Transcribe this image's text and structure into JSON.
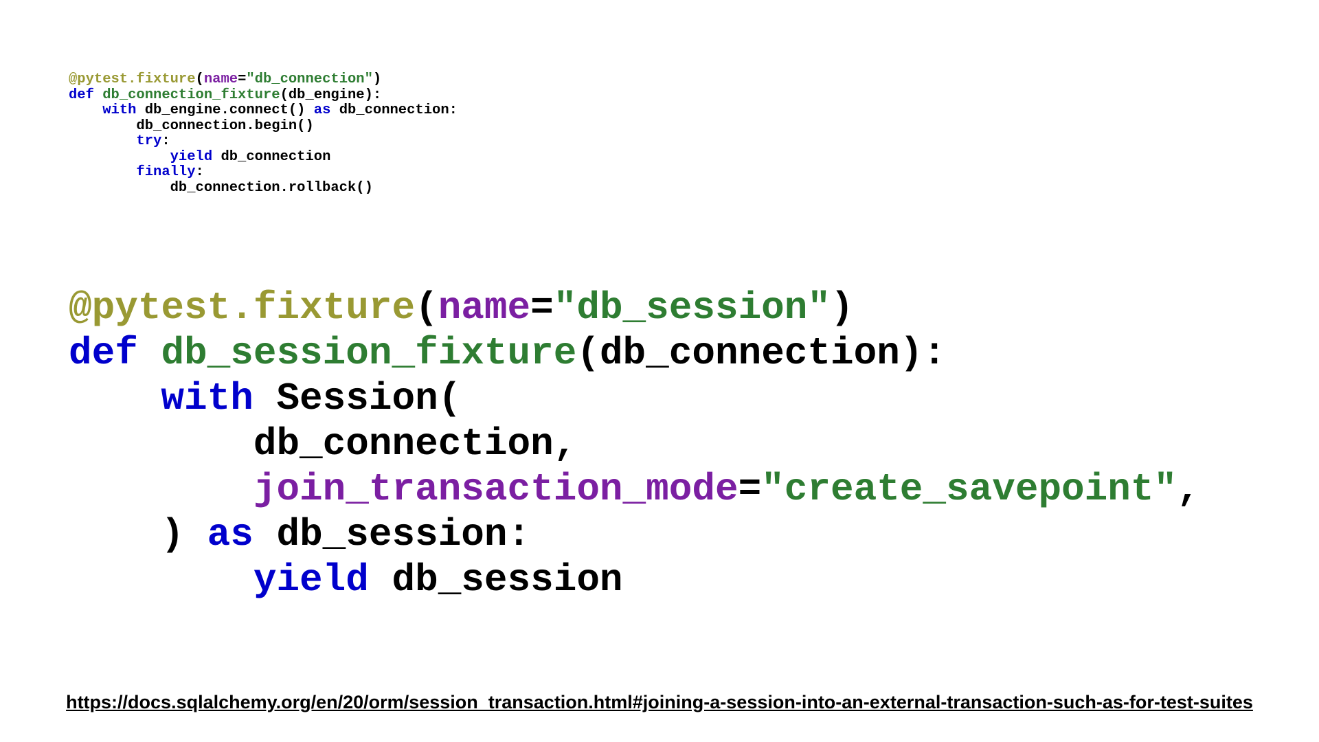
{
  "small_code": {
    "tokens": [
      {
        "cls": "tok-decorator",
        "text": "@pytest.fixture"
      },
      {
        "cls": "tok-default",
        "text": "("
      },
      {
        "cls": "tok-param",
        "text": "name"
      },
      {
        "cls": "tok-default",
        "text": "="
      },
      {
        "cls": "tok-string",
        "text": "\"db_connection\""
      },
      {
        "cls": "tok-default",
        "text": ")\n"
      },
      {
        "cls": "tok-keyword",
        "text": "def"
      },
      {
        "cls": "tok-default",
        "text": " "
      },
      {
        "cls": "tok-funcdef",
        "text": "db_connection_fixture"
      },
      {
        "cls": "tok-default",
        "text": "(db_engine):\n    "
      },
      {
        "cls": "tok-keyword",
        "text": "with"
      },
      {
        "cls": "tok-default",
        "text": " db_engine.connect() "
      },
      {
        "cls": "tok-keyword",
        "text": "as"
      },
      {
        "cls": "tok-default",
        "text": " db_connection:\n        db_connection.begin()\n        "
      },
      {
        "cls": "tok-keyword",
        "text": "try"
      },
      {
        "cls": "tok-default",
        "text": ":\n            "
      },
      {
        "cls": "tok-keyword",
        "text": "yield"
      },
      {
        "cls": "tok-default",
        "text": " db_connection\n        "
      },
      {
        "cls": "tok-keyword",
        "text": "finally"
      },
      {
        "cls": "tok-default",
        "text": ":\n            db_connection.rollback()"
      }
    ]
  },
  "large_code": {
    "tokens": [
      {
        "cls": "tok-decorator",
        "text": "@pytest.fixture"
      },
      {
        "cls": "tok-default",
        "text": "("
      },
      {
        "cls": "tok-param",
        "text": "name"
      },
      {
        "cls": "tok-default",
        "text": "="
      },
      {
        "cls": "tok-string",
        "text": "\"db_session\""
      },
      {
        "cls": "tok-default",
        "text": ")\n"
      },
      {
        "cls": "tok-keyword",
        "text": "def"
      },
      {
        "cls": "tok-default",
        "text": " "
      },
      {
        "cls": "tok-funcdef",
        "text": "db_session_fixture"
      },
      {
        "cls": "tok-default",
        "text": "(db_connection):\n    "
      },
      {
        "cls": "tok-keyword",
        "text": "with"
      },
      {
        "cls": "tok-default",
        "text": " Session(\n        db_connection,\n        "
      },
      {
        "cls": "tok-param",
        "text": "join_transaction_mode"
      },
      {
        "cls": "tok-default",
        "text": "="
      },
      {
        "cls": "tok-string",
        "text": "\"create_savepoint\""
      },
      {
        "cls": "tok-default",
        "text": ",\n    ) "
      },
      {
        "cls": "tok-keyword",
        "text": "as"
      },
      {
        "cls": "tok-default",
        "text": " db_session:\n        "
      },
      {
        "cls": "tok-keyword",
        "text": "yield"
      },
      {
        "cls": "tok-default",
        "text": " db_session"
      }
    ]
  },
  "url": "https://docs.sqlalchemy.org/en/20/orm/session_transaction.html#joining-a-session-into-an-external-transaction-such-as-for-test-suites"
}
